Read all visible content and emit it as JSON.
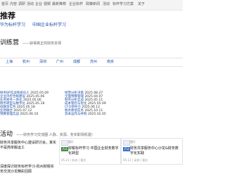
{
  "topnav": {
    "items": [
      "首页",
      "内容",
      "调研",
      "活动",
      "企业",
      "视频",
      "最新推荐",
      "企业标杆",
      "政策新闻",
      "活动",
      "标杆学习方案",
      "关于"
    ]
  },
  "sections": {
    "recommend_title": "推荐",
    "crumbs": [
      "华为标杆学习",
      "中国企业标杆学习"
    ],
    "training_title": "训练营",
    "training_sub": "——获得真正的财务本领",
    "activity_title": "活动",
    "activity_sub": "——财务学习交流圈·人脉、资源、务实职场机遇！"
  },
  "cities": [
    "上海",
    "杭州",
    "深圳",
    "广州",
    "成都",
    "苏州",
    "南京"
  ],
  "news": [
    {
      "title": "财务BP实战系统化人",
      "date": "2025.05.09"
    },
    {
      "title": "企业内控合规建设",
      "date": "2025.05.06"
    },
    {
      "title": "业务财务一体化",
      "date": "2025.05.06"
    },
    {
      "title": "财务转型与数字化",
      "date": "2025.05.18"
    },
    {
      "title": "投融资实务",
      "date": "2025.05.18"
    },
    {
      "title": "业财融合",
      "date": "2025.07.12"
    },
    {
      "title": "预算管理实战",
      "date": "2025.06.10"
    },
    {
      "title": "经营分析决策",
      "date": "2025.08.27"
    },
    {
      "title": "全面预算管理",
      "date": "2025.04.07"
    },
    {
      "title": "财务分析实战",
      "date": "2025.05.11"
    },
    {
      "title": "成本管控与优化",
      "date": "2025.05.09"
    },
    {
      "title": "CFO领导力",
      "date": "2025.06.12"
    },
    {
      "title": "税务筹划实务",
      "date": "2025.10.11"
    },
    {
      "title": "资本运作与并购",
      "date": "2025.02.05"
    }
  ],
  "activity": {
    "left_items": [
      "财务共享服务中心建设研讨会，真实不是简单搬运工",
      "深度探讨财务标杆学习-杭州财税实务交流沙龙精彩回顾"
    ],
    "cards": [
      {
        "cap": "图片",
        "tag": "活动",
        "title": "财税标杆学习 中国企业财务数字化转型",
        "meta": "05.21 | 杭州 | 报名"
      },
      {
        "cap": "图片",
        "tag": "活动",
        "title": "财务共享服务中心沙龙&财务数字化实践",
        "meta": "05.12 | 深圳 | 报名"
      }
    ]
  }
}
